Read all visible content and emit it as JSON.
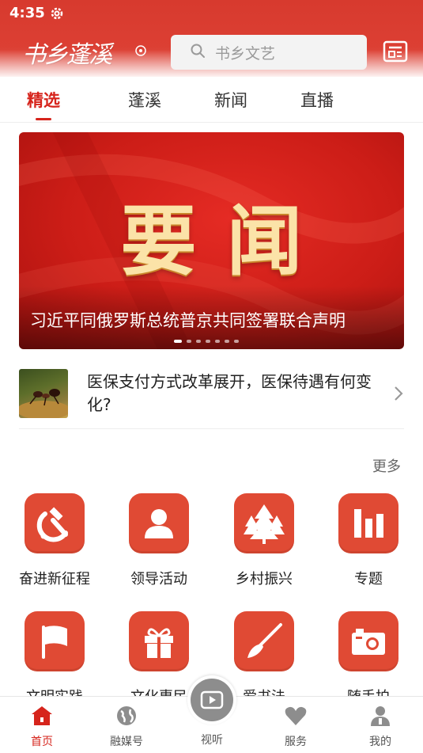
{
  "status": {
    "time": "4:35"
  },
  "header": {
    "logo_text": "书乡蓬溪",
    "search_placeholder": "书乡文艺"
  },
  "tabs": [
    {
      "label": "精选",
      "active": true
    },
    {
      "label": "蓬溪",
      "active": false
    },
    {
      "label": "新闻",
      "active": false
    },
    {
      "label": "直播",
      "active": false
    }
  ],
  "banner": {
    "title": "要闻",
    "caption": "习近平同俄罗斯总统普京共同签署联合声明",
    "dot_count": 7,
    "active_dot": 0
  },
  "news": {
    "title": "医保支付方式改革展开，医保待遇有何变化?"
  },
  "grid": {
    "more_label": "更多",
    "items": [
      {
        "label": "奋进新征程",
        "icon": "hammer-sickle-icon"
      },
      {
        "label": "领导活动",
        "icon": "person-icon"
      },
      {
        "label": "乡村振兴",
        "icon": "trees-icon"
      },
      {
        "label": "专题",
        "icon": "bar-chart-icon"
      },
      {
        "label": "文明实践",
        "icon": "flag-icon"
      },
      {
        "label": "文化惠民",
        "icon": "gift-icon"
      },
      {
        "label": "爱书法",
        "icon": "brush-icon"
      },
      {
        "label": "随手拍",
        "icon": "camera-icon"
      }
    ]
  },
  "bottom_nav": [
    {
      "label": "首页",
      "icon": "home-icon",
      "active": true
    },
    {
      "label": "融媒号",
      "icon": "globe-icon",
      "active": false
    },
    {
      "label": "视听",
      "icon": "video-icon",
      "active": false
    },
    {
      "label": "服务",
      "icon": "heart-icon",
      "active": false
    },
    {
      "label": "我的",
      "icon": "user-icon",
      "active": false
    }
  ],
  "colors": {
    "brand_red": "#d6241c",
    "header_red": "#d73a2e",
    "icon_tile": "#e04a34"
  }
}
